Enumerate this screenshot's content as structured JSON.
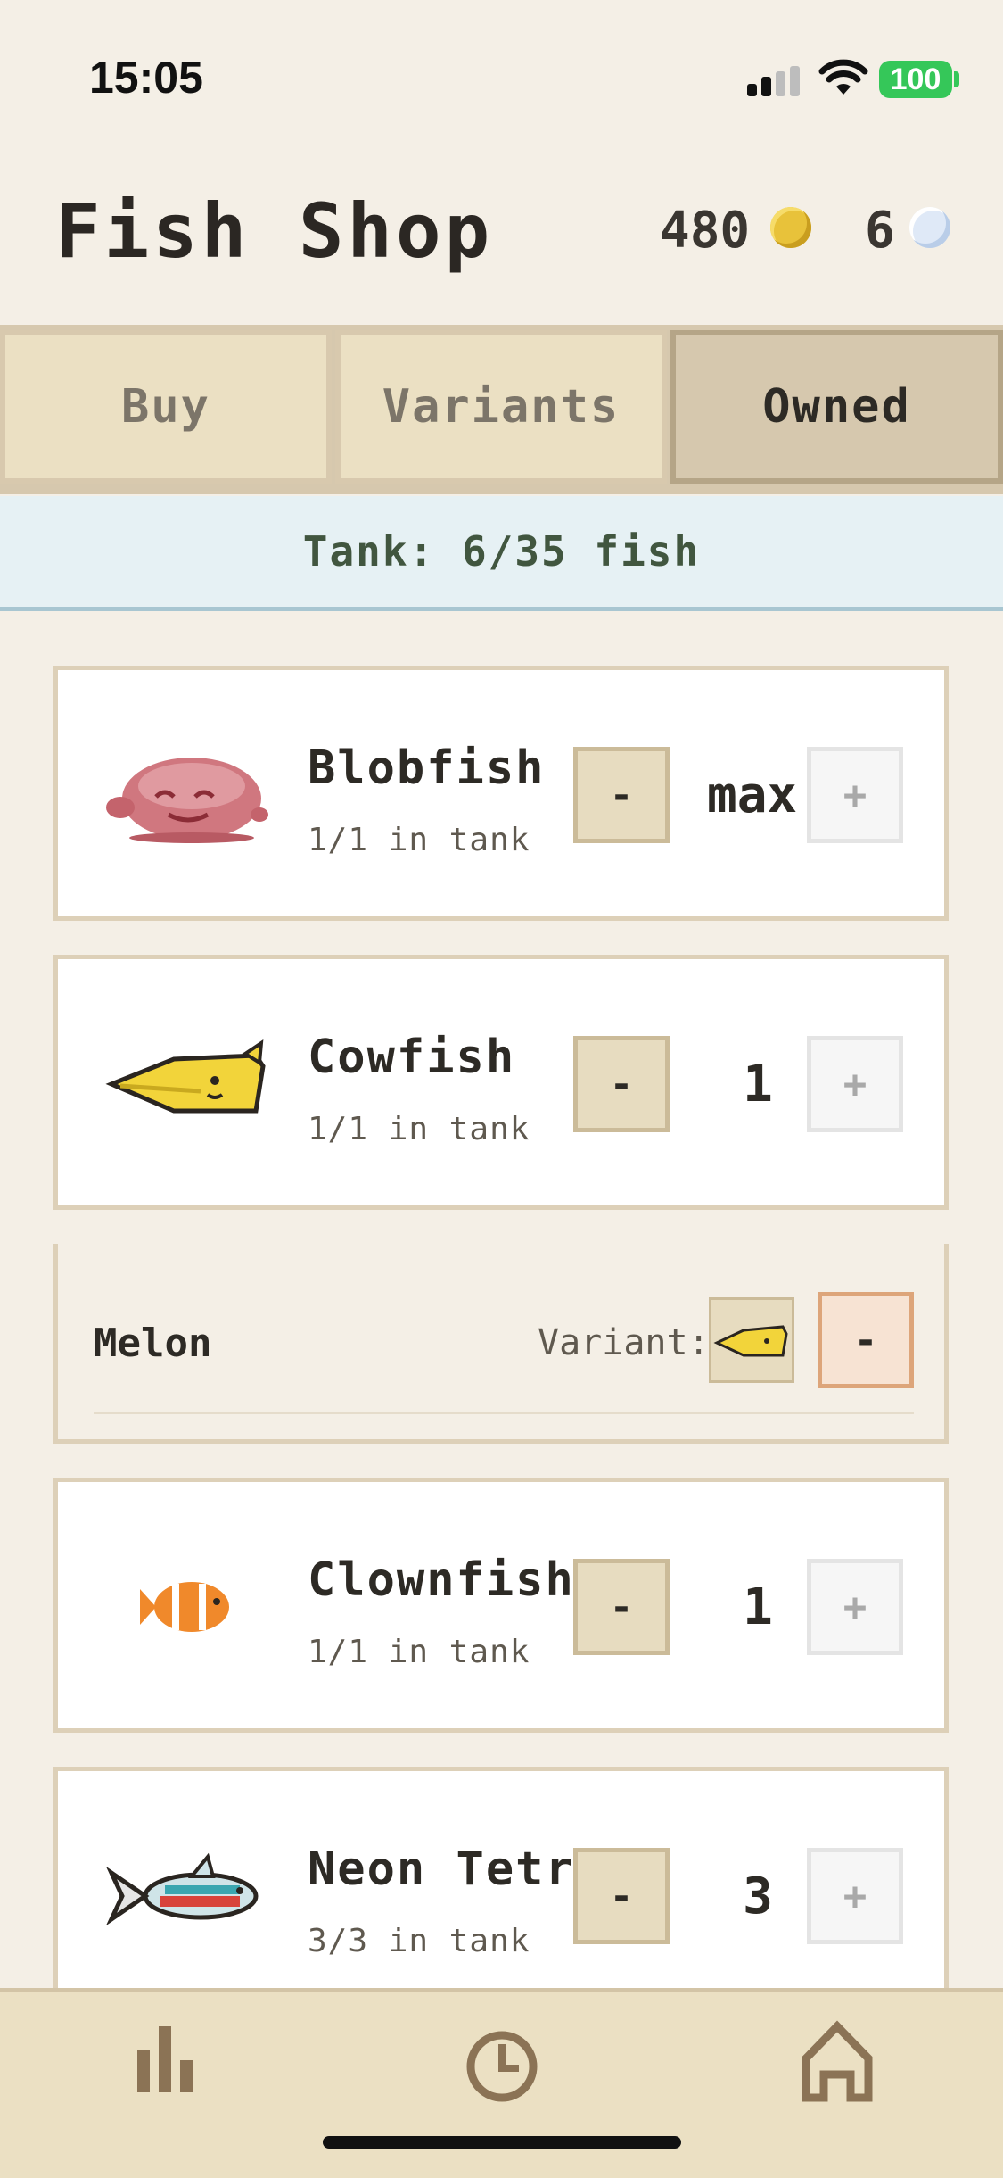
{
  "status_bar": {
    "time": "15:05",
    "battery": "100"
  },
  "header": {
    "title": "Fish Shop",
    "coins": "480",
    "pearls": "6"
  },
  "tabs": [
    {
      "label": "Buy",
      "active": false
    },
    {
      "label": "Variants",
      "active": false
    },
    {
      "label": "Owned",
      "active": true
    }
  ],
  "tank": {
    "summary": "Tank: 6/35 fish"
  },
  "fish": [
    {
      "name": "Blobfish",
      "count": "1/1 in tank",
      "quantity": "max",
      "minus": "-",
      "plus": "+"
    },
    {
      "name": "Cowfish",
      "count": "1/1 in tank",
      "quantity": "1",
      "minus": "-",
      "plus": "+"
    },
    {
      "name": "Clownfish",
      "count": "1/1 in tank",
      "quantity": "1",
      "minus": "-",
      "plus": "+"
    },
    {
      "name": "Neon Tetra",
      "count": "3/3 in tank",
      "quantity": "3",
      "minus": "-",
      "plus": "+"
    }
  ],
  "variant": {
    "name": "Melon",
    "label": "Variant:",
    "remove": "-"
  },
  "colors": {
    "background": "#f4efe6",
    "tab_active": "#d6c8ae",
    "tab_inactive": "#ebe0c3",
    "tank_banner": "#e6f1f4",
    "battery": "#35c759",
    "coin": "#e8c23a"
  },
  "icons": {
    "nav": [
      "stats-icon",
      "timer-icon",
      "home-icon"
    ],
    "currency": [
      "coin-icon",
      "pearl-icon"
    ]
  }
}
